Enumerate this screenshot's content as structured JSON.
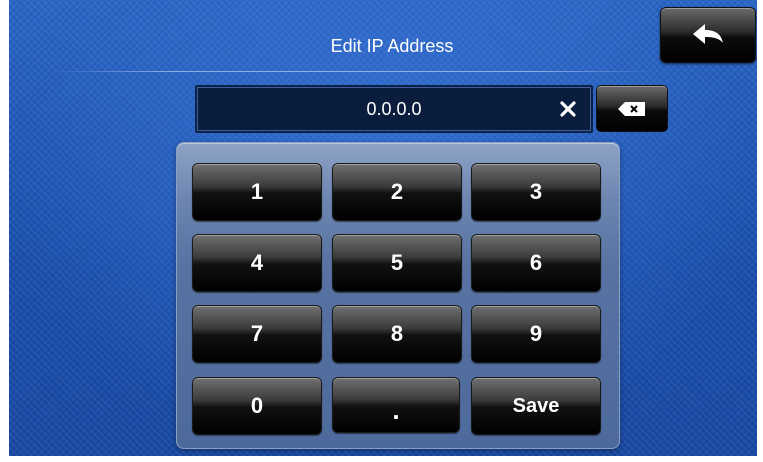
{
  "header": {
    "title": "Edit IP Address"
  },
  "ip_input": {
    "value": "0.0.0.0"
  },
  "icons": {
    "back": "back-arrow-icon",
    "clear": "close-icon",
    "backspace": "backspace-icon"
  },
  "keypad": {
    "keys": [
      "1",
      "2",
      "3",
      "4",
      "5",
      "6",
      "7",
      "8",
      "9",
      "0",
      ".",
      "Save"
    ]
  },
  "colors": {
    "background": "#1f56b8",
    "button": "#000000",
    "text": "#ffffff"
  }
}
